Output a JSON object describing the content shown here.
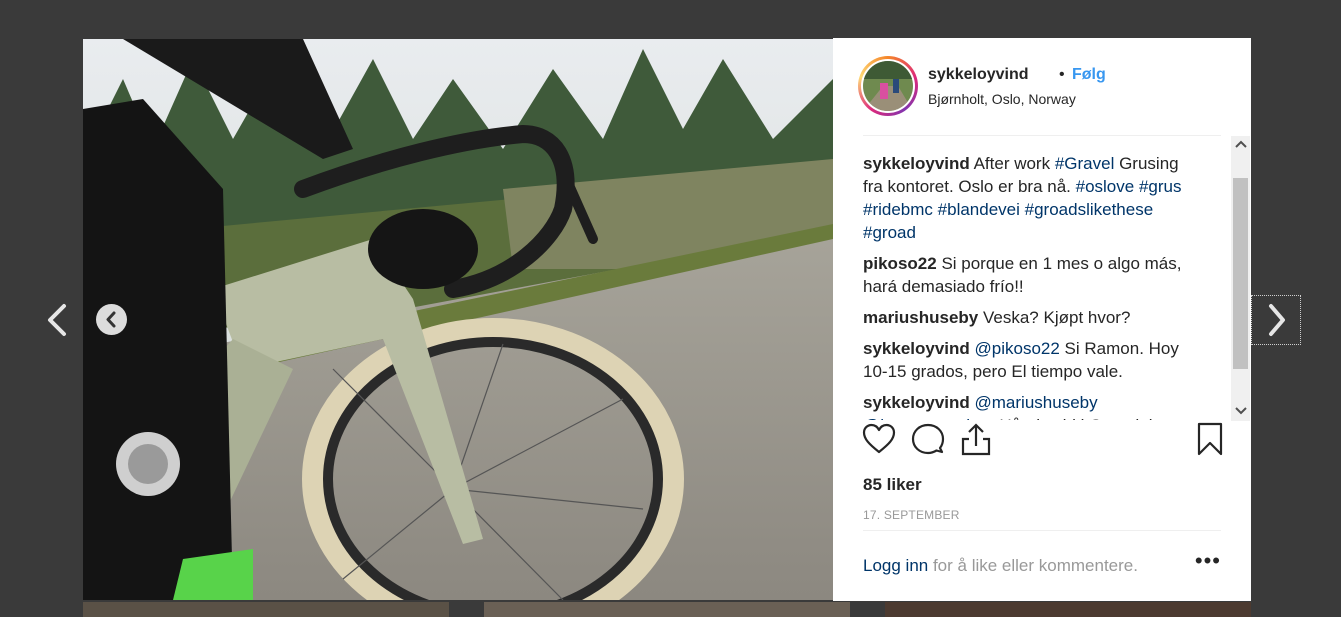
{
  "post": {
    "username": "sykkeloyvind",
    "dot": "•",
    "follow_label": "Følg",
    "location": "Bjørnholt, Oslo, Norway"
  },
  "comments": [
    {
      "user": "sykkeloyvind",
      "parts": [
        {
          "t": "After work ",
          "tag": false
        },
        {
          "t": "#Gravel",
          "tag": true
        },
        {
          "t": " Grusing fra kontoret. Oslo er bra nå. ",
          "tag": false
        },
        {
          "t": "#oslove",
          "tag": true
        },
        {
          "t": " ",
          "tag": false
        },
        {
          "t": "#grus",
          "tag": true
        },
        {
          "t": " ",
          "tag": false
        },
        {
          "t": "#ridebmc",
          "tag": true
        },
        {
          "t": " ",
          "tag": false
        },
        {
          "t": "#blandevei",
          "tag": true
        },
        {
          "t": " ",
          "tag": false
        },
        {
          "t": "#groadslikethese",
          "tag": true
        },
        {
          "t": " ",
          "tag": false
        },
        {
          "t": "#groad",
          "tag": true
        }
      ]
    },
    {
      "user": "pikoso22",
      "parts": [
        {
          "t": "Si porque en 1 mes o algo más, hará demasiado frío!!",
          "tag": false
        }
      ]
    },
    {
      "user": "mariushuseby",
      "parts": [
        {
          "t": "Veska? Kjøpt hvor?",
          "tag": false
        }
      ]
    },
    {
      "user": "sykkeloyvind",
      "parts": [
        {
          "t": "@pikoso22",
          "tag": true
        },
        {
          "t": " Si Ramon. Hoy 10-15 grados, pero El tiempo vale.",
          "tag": false
        }
      ]
    },
    {
      "user": "sykkeloyvind",
      "parts": [
        {
          "t": "@mariushuseby",
          "tag": true
        },
        {
          "t": " ",
          "tag": false
        },
        {
          "t": "@haugenoutdoor",
          "tag": true
        },
        {
          "t": " Håndsydd i Gausdal",
          "tag": false
        }
      ]
    }
  ],
  "likes": "85 liker",
  "date": "17. SEPTEMBER",
  "login": {
    "link": "Logg inn",
    "rest": " for å like eller kommentere.",
    "more": "•••"
  },
  "icons": {
    "like": "heart-icon",
    "comment": "comment-icon",
    "share": "share-icon",
    "save": "bookmark-icon",
    "prev": "chevron-left-icon",
    "next": "chevron-right-icon",
    "scroll_up": "scroll-up-arrow-icon",
    "scroll_down": "scroll-down-arrow-icon"
  },
  "colors": {
    "follow": "#3897f0",
    "hashtag": "#003569",
    "overlay": "#3a3a3a"
  }
}
